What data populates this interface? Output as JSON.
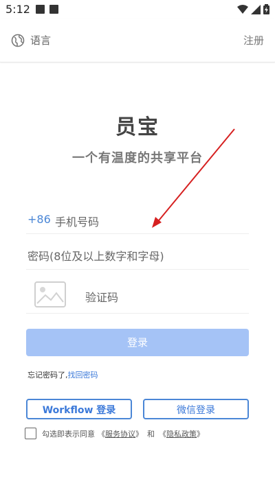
{
  "status_bar": {
    "time": "5:12"
  },
  "header": {
    "language_label": "语言",
    "register_label": "注册"
  },
  "brand": {
    "name": "员宝",
    "slogan": "一个有温度的共享平台"
  },
  "form": {
    "country_code": "+86",
    "phone_placeholder": "手机号码",
    "password_placeholder": "密码(8位及以上数字和字母)",
    "captcha_placeholder": "验证码",
    "login_label": "登录"
  },
  "forgot": {
    "text": "忘记密码了,",
    "link": "找回密码"
  },
  "alt_login": {
    "workflow_label": "Workflow 登录",
    "wechat_label": "微信登录"
  },
  "agreement": {
    "prefix": "勾选即表示同意",
    "open1": "《",
    "service": "服务协议",
    "close1": "》",
    "and": "和",
    "open2": "《",
    "privacy": "隐私政策",
    "close2": "》"
  },
  "colors": {
    "accent": "#4a86d6",
    "button_disabled": "#a5c3f6",
    "annotation": "#d62020"
  }
}
